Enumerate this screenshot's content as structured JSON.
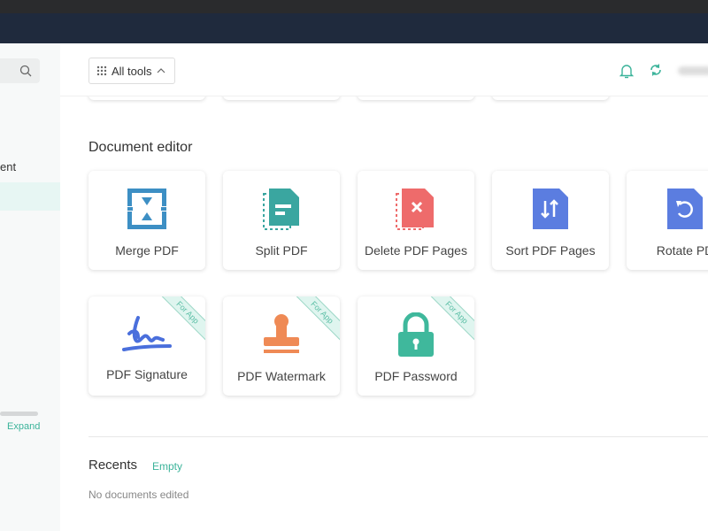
{
  "sidebar": {
    "partial_item": "ent",
    "expand": "Expand"
  },
  "header": {
    "all_tools": "All tools"
  },
  "section": {
    "title": "Document editor"
  },
  "tools": [
    {
      "label": "Merge PDF",
      "icon": "merge-icon",
      "color": "#3d8fc4"
    },
    {
      "label": "Split PDF",
      "icon": "split-icon",
      "color": "#3aa6a0"
    },
    {
      "label": "Delete PDF Pages",
      "icon": "delete-pages-icon",
      "color": "#ee6b6b"
    },
    {
      "label": "Sort PDF Pages",
      "icon": "sort-pages-icon",
      "color": "#5b7de0"
    },
    {
      "label": "Rotate PD",
      "icon": "rotate-icon",
      "color": "#5b7de0"
    },
    {
      "label": "PDF Signature",
      "icon": "signature-icon",
      "color": "#4a6fdc",
      "badge": "For App"
    },
    {
      "label": "PDF Watermark",
      "icon": "stamp-icon",
      "color": "#ef8a55",
      "badge": "For App"
    },
    {
      "label": "PDF Password",
      "icon": "lock-icon",
      "color": "#3fb89c",
      "badge": "For App"
    }
  ],
  "recents": {
    "title": "Recents",
    "empty_link": "Empty",
    "empty_text": "No documents edited"
  },
  "colors": {
    "accent": "#3bb39a",
    "navbar": "#1f2a3d"
  }
}
